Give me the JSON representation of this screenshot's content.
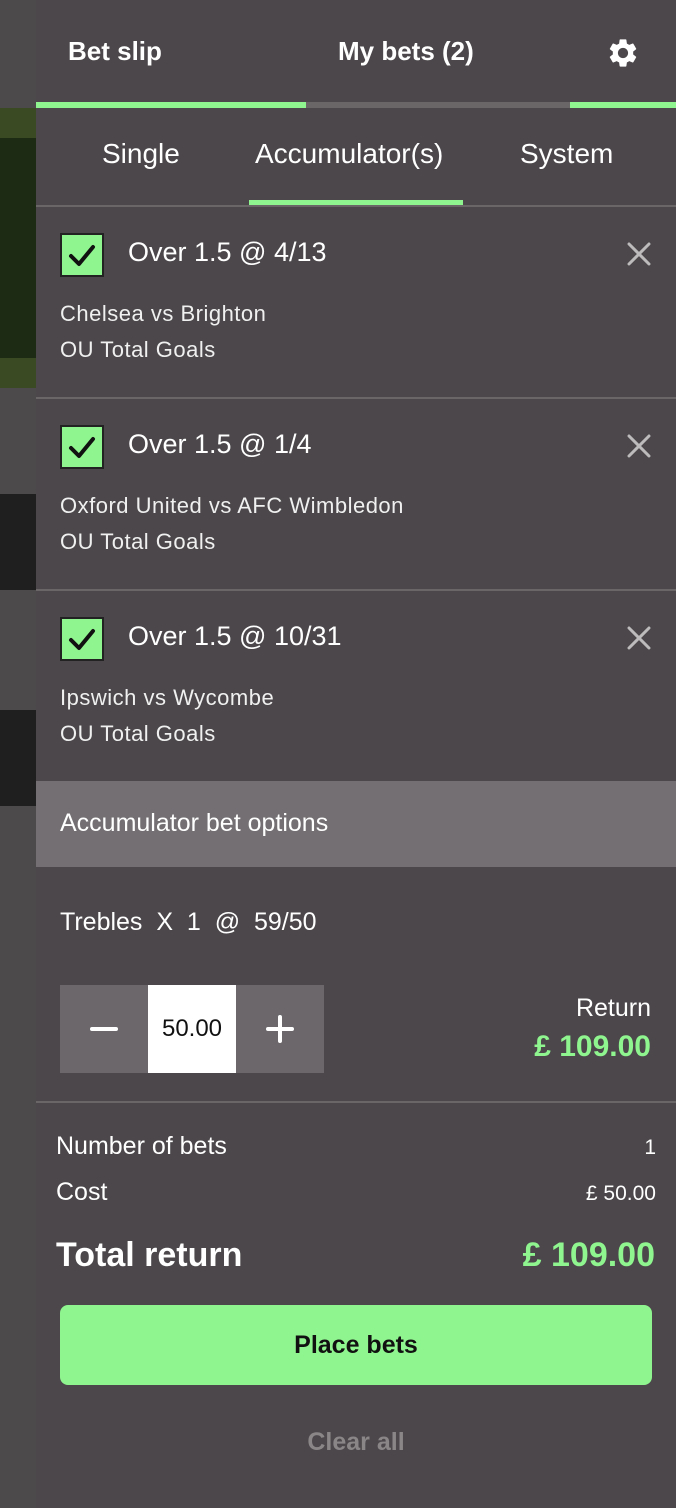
{
  "header": {
    "tab_betslip": "Bet slip",
    "tab_mybets": "My bets (2)",
    "settings_icon": "gear-icon"
  },
  "subtabs": [
    "Single",
    "Accumulator(s)",
    "System"
  ],
  "selections": [
    {
      "title": "Over 1.5 @ 4/13",
      "match": "Chelsea vs Brighton",
      "market": "OU Total Goals",
      "checked": true
    },
    {
      "title": "Over 1.5 @ 1/4",
      "match": "Oxford United vs AFC Wimbledon",
      "market": "OU Total Goals",
      "checked": true
    },
    {
      "title": "Over 1.5 @ 10/31",
      "match": "Ipswich vs Wycombe",
      "market": "OU Total Goals",
      "checked": true
    }
  ],
  "options": {
    "label": "Accumulator bet options",
    "treble_line": "Trebles  X  1  @  59/50",
    "stake": "50.00",
    "minus_icon": "minus-icon",
    "plus_icon": "plus-icon",
    "return_label": "Return",
    "return_value": "£ 109.00"
  },
  "summary": {
    "bets_label": "Number of bets",
    "bets_value": "1",
    "cost_label": "Cost",
    "cost_value": "£ 50.00",
    "total_label": "Total return",
    "total_value": "£ 109.00"
  },
  "actions": {
    "place": "Place bets",
    "clear": "Clear all"
  },
  "colors": {
    "accent": "#8ff58f",
    "panel": "#4b474a",
    "options_bar": "#736f72"
  }
}
